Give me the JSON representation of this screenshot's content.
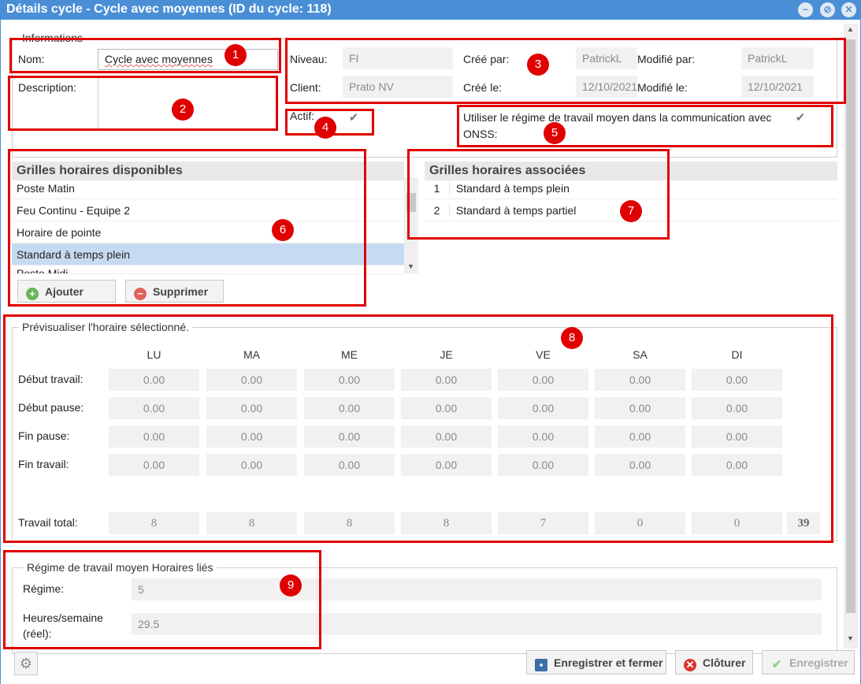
{
  "window": {
    "title": "Détails cycle - Cycle avec moyennes (ID du cycle: 118)"
  },
  "informations": {
    "legend": "Informations",
    "nom_label": "Nom:",
    "nom_value": "Cycle avec moyennes",
    "description_label": "Description:",
    "niveau_label": "Niveau:",
    "niveau_value": "FI",
    "client_label": "Client:",
    "client_value": "Prato NV",
    "cree_par_label": "Créé par:",
    "cree_par_value": "PatrickL",
    "cree_le_label": "Créé le:",
    "cree_le_value": "12/10/2021",
    "modifie_par_label": "Modifié par:",
    "modifie_par_value": "PatrickL",
    "modifie_le_label": "Modifié le:",
    "modifie_le_value": "12/10/2021",
    "actif_label": "Actif:",
    "actif_checked": true,
    "onss_label": "Utiliser le régime de travail moyen dans la communication avec ONSS:",
    "onss_checked": true
  },
  "available": {
    "header": "Grilles horaires disponibles",
    "items": [
      "Poste Matin",
      "Feu Continu - Equipe 2",
      "Horaire de pointe",
      "Standard à temps plein",
      "Poste Midi"
    ],
    "selected": "Standard à temps plein",
    "add_label": "Ajouter",
    "remove_label": "Supprimer"
  },
  "associated": {
    "header": "Grilles horaires associées",
    "items": [
      {
        "num": "1",
        "label": "Standard à temps plein"
      },
      {
        "num": "2",
        "label": "Standard à temps partiel"
      }
    ]
  },
  "preview": {
    "legend": "Prévisualiser l'horaire sélectionné.",
    "days": [
      "LU",
      "MA",
      "ME",
      "JE",
      "VE",
      "SA",
      "DI"
    ],
    "rows": [
      {
        "label": "Début travail:",
        "values": [
          "0.00",
          "0.00",
          "0.00",
          "0.00",
          "0.00",
          "0.00",
          "0.00"
        ]
      },
      {
        "label": "Début pause:",
        "values": [
          "0.00",
          "0.00",
          "0.00",
          "0.00",
          "0.00",
          "0.00",
          "0.00"
        ]
      },
      {
        "label": "Fin pause:",
        "values": [
          "0.00",
          "0.00",
          "0.00",
          "0.00",
          "0.00",
          "0.00",
          "0.00"
        ]
      },
      {
        "label": "Fin travail:",
        "values": [
          "0.00",
          "0.00",
          "0.00",
          "0.00",
          "0.00",
          "0.00",
          "0.00"
        ]
      }
    ],
    "total_label": "Travail total:",
    "totals": [
      "8",
      "8",
      "8",
      "8",
      "7",
      "0",
      "0"
    ],
    "grand_total": "39"
  },
  "regime": {
    "legend": "Régime de travail moyen Horaires liés",
    "regime_label": "Régime:",
    "regime_value": "5",
    "heures_label_1": "Heures/semaine",
    "heures_label_2": "(réel):",
    "heures_value": "29.5"
  },
  "footer": {
    "save_close": "Enregistrer et fermer",
    "close": "Clôturer",
    "save": "Enregistrer"
  },
  "badges": [
    "1",
    "2",
    "3",
    "4",
    "5",
    "6",
    "7",
    "8",
    "9"
  ],
  "colors": {
    "titlebar": "#4a8fd6",
    "annotation": "#e00000",
    "selected_row": "#c6dbf2"
  }
}
